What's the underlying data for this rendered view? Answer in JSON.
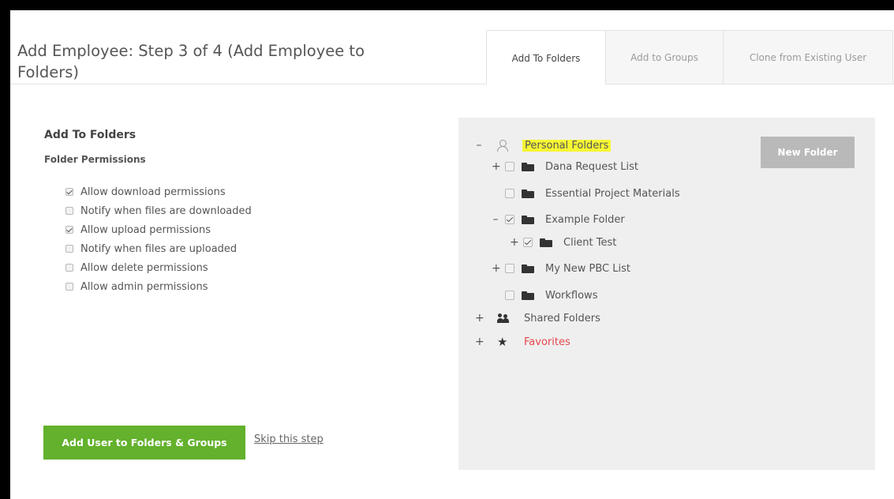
{
  "page": {
    "title": "Add Employee: Step 3 of 4 (Add Employee to Folders)"
  },
  "tabs": [
    {
      "label": "Add To Folders",
      "active": true
    },
    {
      "label": "Add to Groups",
      "active": false
    },
    {
      "label": "Clone from Existing User",
      "active": false
    }
  ],
  "left": {
    "section_title": "Add To Folders",
    "sub_title": "Folder Permissions",
    "permissions": [
      {
        "label": "Allow download permissions",
        "checked": true
      },
      {
        "label": "Notify when files are downloaded",
        "checked": false
      },
      {
        "label": "Allow upload permissions",
        "checked": true
      },
      {
        "label": "Notify when files are uploaded",
        "checked": false
      },
      {
        "label": "Allow delete permissions",
        "checked": false
      },
      {
        "label": "Allow admin permissions",
        "checked": false
      }
    ],
    "primary_button": "Add User to Folders & Groups",
    "skip_link": "Skip this step"
  },
  "tree": {
    "new_folder_button": "New Folder",
    "expand_symbol": "+",
    "collapse_symbol": "–",
    "personal_folders": "Personal Folders",
    "folders": [
      {
        "label": "Dana Request List",
        "checked": false,
        "toggle": "+"
      },
      {
        "label": "Essential Project Materials",
        "checked": false,
        "toggle": ""
      },
      {
        "label": "Example Folder",
        "checked": true,
        "toggle": "–"
      },
      {
        "label": "Client Test",
        "checked": true,
        "toggle": "+"
      },
      {
        "label": "My New PBC List",
        "checked": false,
        "toggle": "+"
      },
      {
        "label": "Workflows",
        "checked": false,
        "toggle": ""
      }
    ],
    "shared_folders": "Shared Folders",
    "favorites": "Favorites",
    "favorites_color": "#e5484d",
    "highlight_color": "#f7f733"
  },
  "colors": {
    "primary_green": "#63b12c",
    "disabled_gray": "#b9b9b9",
    "panel_bg": "#efefef"
  },
  "icons": {
    "personal_folders": "user-outline-icon",
    "folder": "folder-icon",
    "shared_folders": "users-icon",
    "favorites": "star-icon"
  }
}
